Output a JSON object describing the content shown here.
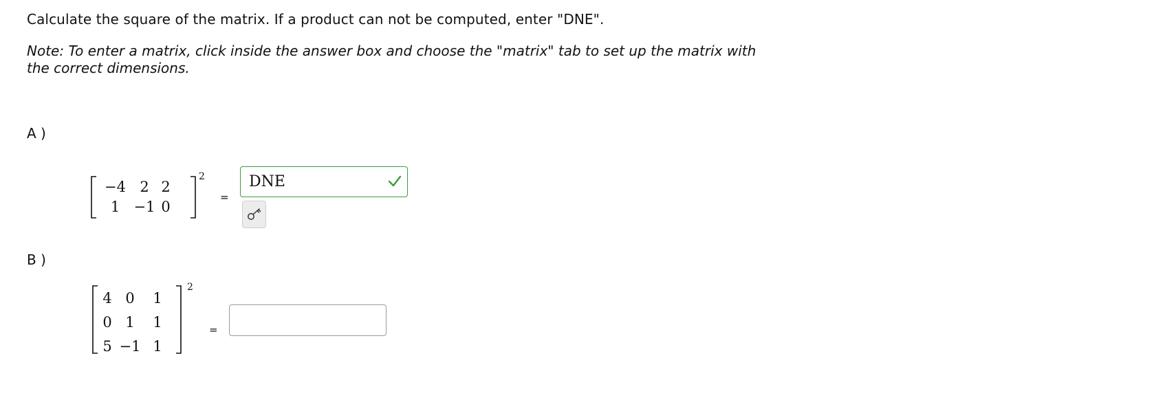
{
  "instructions": "Calculate the square of the matrix. If a product can not be computed, enter \"DNE\".",
  "note": "Note: To enter a matrix, click inside the answer box and choose the \"matrix\" tab to set up the matrix with the correct dimensions.",
  "parts": [
    {
      "label": "A )",
      "matrix": [
        [
          "−4",
          "2",
          "2"
        ],
        [
          "1",
          "−1",
          "0"
        ]
      ],
      "exponent": "2",
      "equals": "=",
      "answer": "DNE",
      "answer_status": "correct",
      "key_icon": "key-icon"
    },
    {
      "label": "B )",
      "matrix": [
        [
          "4",
          "0",
          "1"
        ],
        [
          "0",
          "1",
          "1"
        ],
        [
          "5",
          "−1",
          "1"
        ]
      ],
      "exponent": "2",
      "equals": "=",
      "answer": ""
    }
  ],
  "colors": {
    "correct_border": "#3b9b3b",
    "checkmark": "#3b9b3b",
    "empty_border": "#9a9a9a",
    "key_button_bg": "#ececec"
  }
}
